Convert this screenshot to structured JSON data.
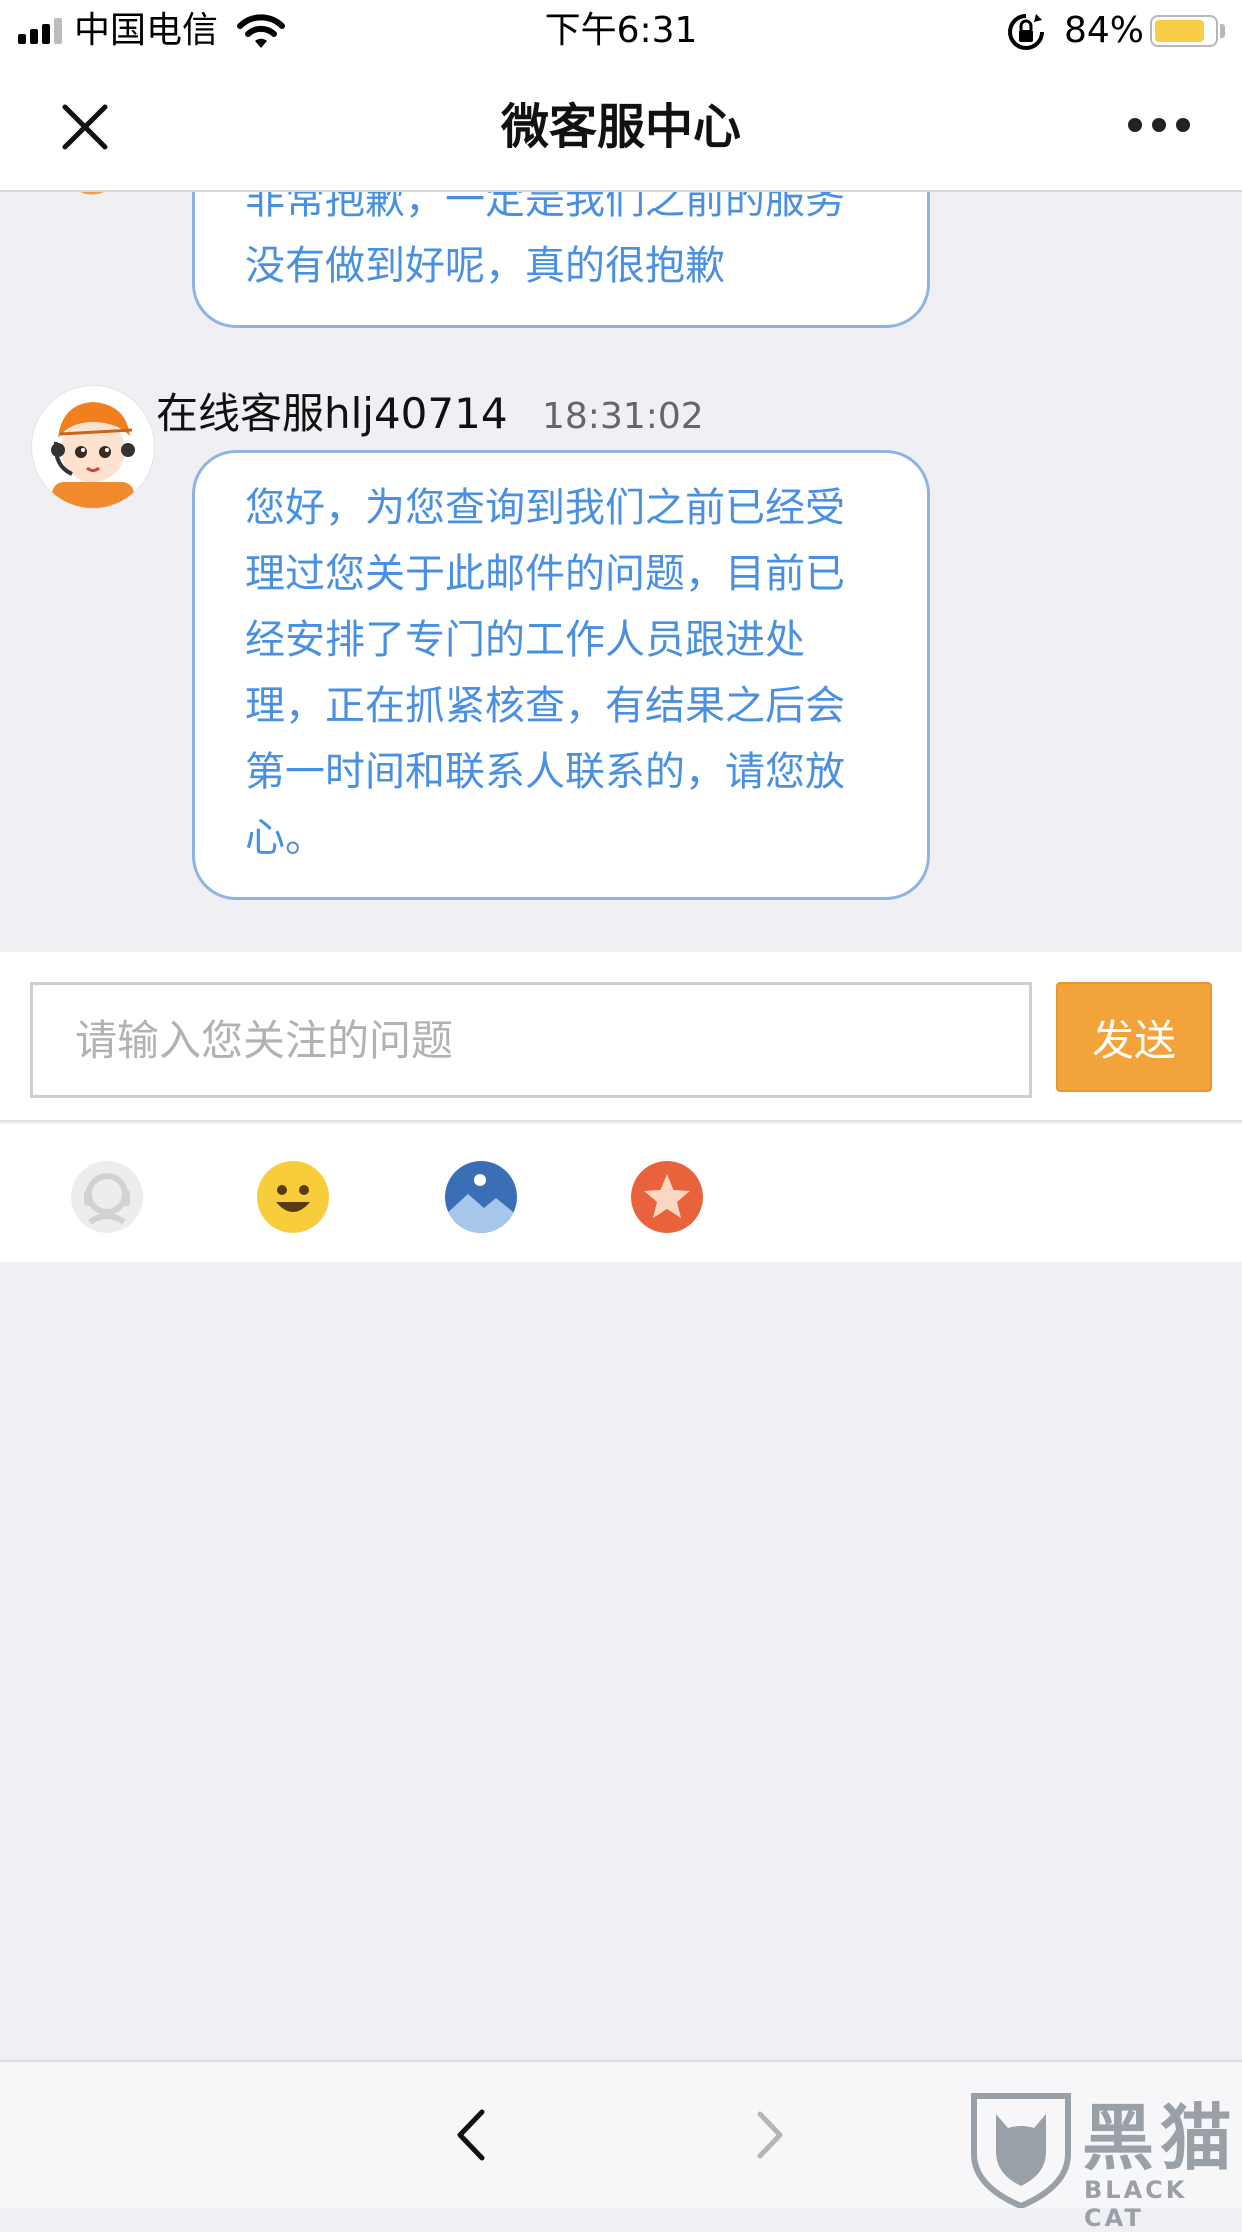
{
  "status_bar": {
    "carrier": "中国电信",
    "time": "下午6:31",
    "battery_percent": "84%",
    "battery_level": 0.84
  },
  "nav": {
    "title": "微客服中心",
    "close_icon": "close-icon",
    "more_icon": "more-icon"
  },
  "chat": {
    "messages": [
      {
        "lines": [
          "非常抱歉，一定是我们之前的服务",
          "没有做到好呢，真的很抱歉"
        ]
      },
      {
        "sender": "在线客服hlj40714",
        "time": "18:31:02",
        "lines": [
          "您好，为您查询到我们之前已经受",
          "理过您关于此邮件的问题，目前已",
          "经安排了专门的工作人员跟进处",
          "理，正在抓紧核查，有结果之后会",
          "第一时间和联系人联系的，请您放",
          "心。"
        ]
      }
    ]
  },
  "input": {
    "placeholder": "请输入您关注的问题",
    "value": "",
    "send_label": "发送"
  },
  "toolbar": {
    "icons": [
      "agent-icon",
      "emoji-icon",
      "image-icon",
      "star-icon"
    ]
  },
  "bottom_nav": {
    "back_icon": "chevron-left-icon",
    "forward_icon": "chevron-right-icon"
  },
  "watermark": {
    "text": "黑猫",
    "subtext": "BLACK CAT"
  },
  "colors": {
    "bubble_text": "#4a90e2",
    "bubble_border": "#8fb4e3",
    "send_button": "#f2a33a",
    "background": "#efeff4"
  }
}
